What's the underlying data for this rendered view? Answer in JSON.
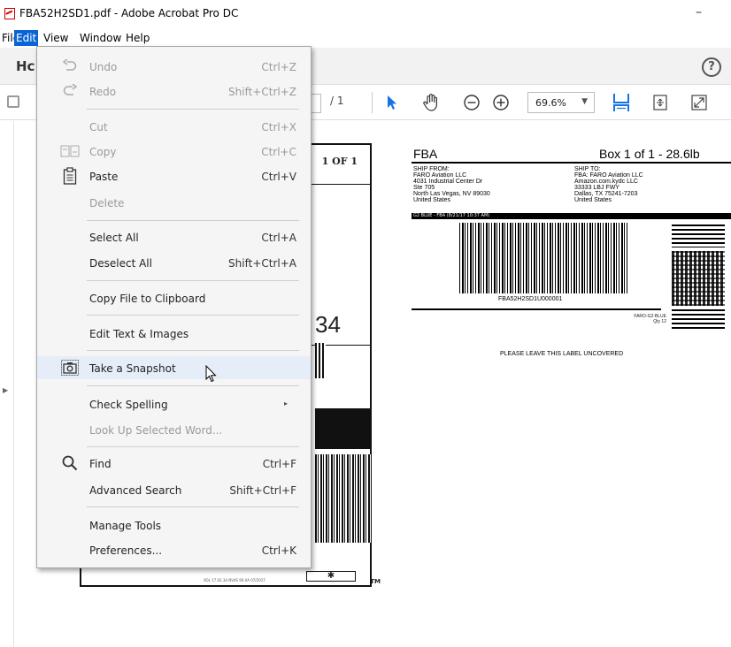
{
  "window": {
    "title": "FBA52H2SD1.pdf - Adobe Acrobat Pro DC",
    "minimize_glyph": "–"
  },
  "menubar": {
    "items": [
      "File",
      "Edit",
      "View",
      "Window",
      "Help"
    ],
    "active": "Edit"
  },
  "tabbar": {
    "home_tab": "Hc",
    "help_glyph": "?"
  },
  "toolbar": {
    "page_total": "/ 1",
    "zoom": "69.6%",
    "zoom_caret": "▼"
  },
  "edit_menu": {
    "items": [
      {
        "label": "Undo",
        "shortcut": "Ctrl+Z",
        "icon": "undo-icon",
        "disabled": true
      },
      {
        "label": "Redo",
        "shortcut": "Shift+Ctrl+Z",
        "icon": "redo-icon",
        "disabled": true
      },
      {
        "label": "Cut",
        "shortcut": "Ctrl+X",
        "disabled": true
      },
      {
        "label": "Copy",
        "shortcut": "Ctrl+C",
        "icon": "copy-icon",
        "disabled": true
      },
      {
        "label": "Paste",
        "shortcut": "Ctrl+V",
        "icon": "clipboard-icon",
        "disabled": false
      },
      {
        "label": "Delete",
        "shortcut": "",
        "disabled": true
      },
      {
        "label": "Select All",
        "shortcut": "Ctrl+A",
        "disabled": false
      },
      {
        "label": "Deselect All",
        "shortcut": "Shift+Ctrl+A",
        "disabled": false
      },
      {
        "label": "Copy File to Clipboard",
        "shortcut": "",
        "disabled": false
      },
      {
        "label": "Edit Text & Images",
        "shortcut": "",
        "disabled": false
      },
      {
        "label": "Take a Snapshot",
        "shortcut": "",
        "icon": "camera-icon",
        "disabled": false,
        "hovered": true
      },
      {
        "label": "Check Spelling",
        "shortcut": "",
        "submenu_glyph": "▸",
        "disabled": false
      },
      {
        "label": "Look Up Selected Word...",
        "shortcut": "",
        "disabled": true
      },
      {
        "label": "Find",
        "shortcut": "Ctrl+F",
        "icon": "search-icon",
        "disabled": false
      },
      {
        "label": "Advanced Search",
        "shortcut": "Shift+Ctrl+F",
        "disabled": false
      },
      {
        "label": "Manage Tools",
        "shortcut": "",
        "disabled": false
      },
      {
        "label": "Preferences...",
        "shortcut": "Ctrl+K",
        "disabled": false
      }
    ]
  },
  "document": {
    "label1": {
      "count": "1 OF 1",
      "big_number": "34",
      "footer": "XOL 17.02.34    NV4S 90.0A 07/2017",
      "tm": "TM"
    },
    "label2": {
      "title": "FBA",
      "box": "Box 1 of 1 - 28.6lb",
      "ship_from": "SHIP FROM:\nFARO Aviation LLC\n4031 Industrial Center Dr\nSte 705\nNorth Las Vegas, NV 89030\nUnited States",
      "ship_to": "SHIP TO:\nFBA: FARO Aviation LLC\nAmazon.com.kydc LLC\n33333 LBJ FWY\nDallas, TX 75241-7203\nUnited States",
      "bar_text": "G2 BLUE - FBA (8/21/17 10:37 AM)",
      "barcode_number": "FBA52H2SD1U000001",
      "sku": "FARO-G2-BLUE\nQty 12",
      "notice": "PLEASE LEAVE THIS LABEL UNCOVERED"
    }
  },
  "colors": {
    "menu_active": "#0a64d6",
    "hover": "#e5eef8",
    "accent_blue": "#1473e6"
  }
}
